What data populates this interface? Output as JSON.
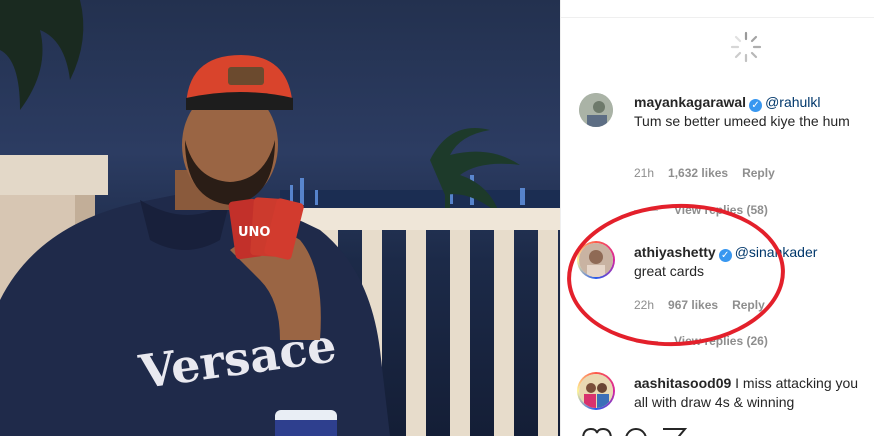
{
  "comments": [
    {
      "username": "mayankagarawal",
      "verified": true,
      "mention": "@rahulkl",
      "text": "Tum se better umeed kiye the hum",
      "time": "21h",
      "likes": "1,632 likes",
      "reply": "Reply",
      "view_replies": "View replies (58)"
    },
    {
      "username": "athiyashetty",
      "verified": true,
      "mention": "@sinankader",
      "text": "great cards",
      "time": "22h",
      "likes": "967 likes",
      "reply": "Reply",
      "view_replies": "View replies (26)"
    },
    {
      "username": "aashitasood09",
      "verified": false,
      "text": "I miss attacking you all with draw 4s & winning"
    }
  ],
  "photo": {
    "cap_text": "",
    "jersey_text": "Versace",
    "card_text": "UNO"
  },
  "icons": {
    "verified": "verified-badge-icon",
    "spinner": "loading-spinner-icon"
  },
  "colors": {
    "annotation": "#e3202b",
    "verified": "#3897f0",
    "mention": "#00376b"
  }
}
